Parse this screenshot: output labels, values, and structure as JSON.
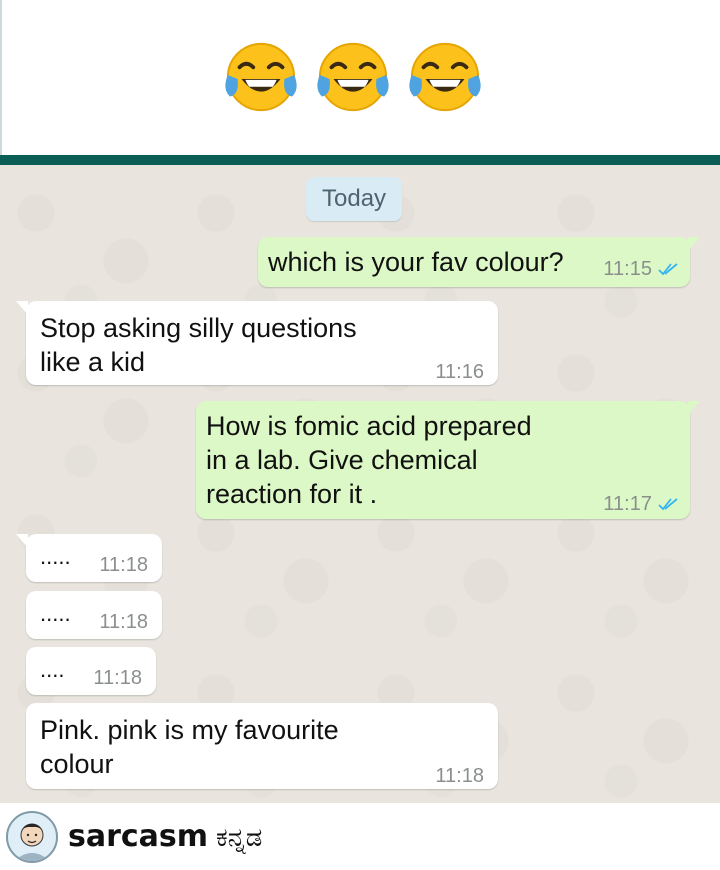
{
  "header": {
    "emojis": [
      "face-with-tears-of-joy-icon",
      "face-with-tears-of-joy-icon",
      "face-with-tears-of-joy-icon"
    ]
  },
  "colors": {
    "divider": "#0b5e55",
    "chat_background": "#e9e5de",
    "outgoing_bubble": "#dcf8c6",
    "incoming_bubble": "#ffffff",
    "read_ticks": "#34b7f1"
  },
  "chat": {
    "date_label": "Today",
    "messages": [
      {
        "direction": "outgoing",
        "text": "which is your fav colour?",
        "time": "11:15",
        "read": true
      },
      {
        "direction": "incoming",
        "text": "Stop asking silly questions\nlike a kid",
        "time": "11:16"
      },
      {
        "direction": "outgoing",
        "text": "How is fomic acid prepared\nin a lab. Give chemical\nreaction for it .",
        "time": "11:17",
        "read": true
      },
      {
        "direction": "incoming",
        "text": ".....",
        "time": "11:18"
      },
      {
        "direction": "incoming",
        "text": ".....",
        "time": "11:18"
      },
      {
        "direction": "incoming",
        "text": "....",
        "time": "11:18"
      },
      {
        "direction": "incoming",
        "text": "Pink. pink is my favourite\ncolour",
        "time": "11:18"
      }
    ]
  },
  "footer": {
    "brand_name": "sarcasm",
    "brand_suffix": "ಕನ್ನಡ",
    "avatar_icon": "cartoon-avatar-icon"
  }
}
